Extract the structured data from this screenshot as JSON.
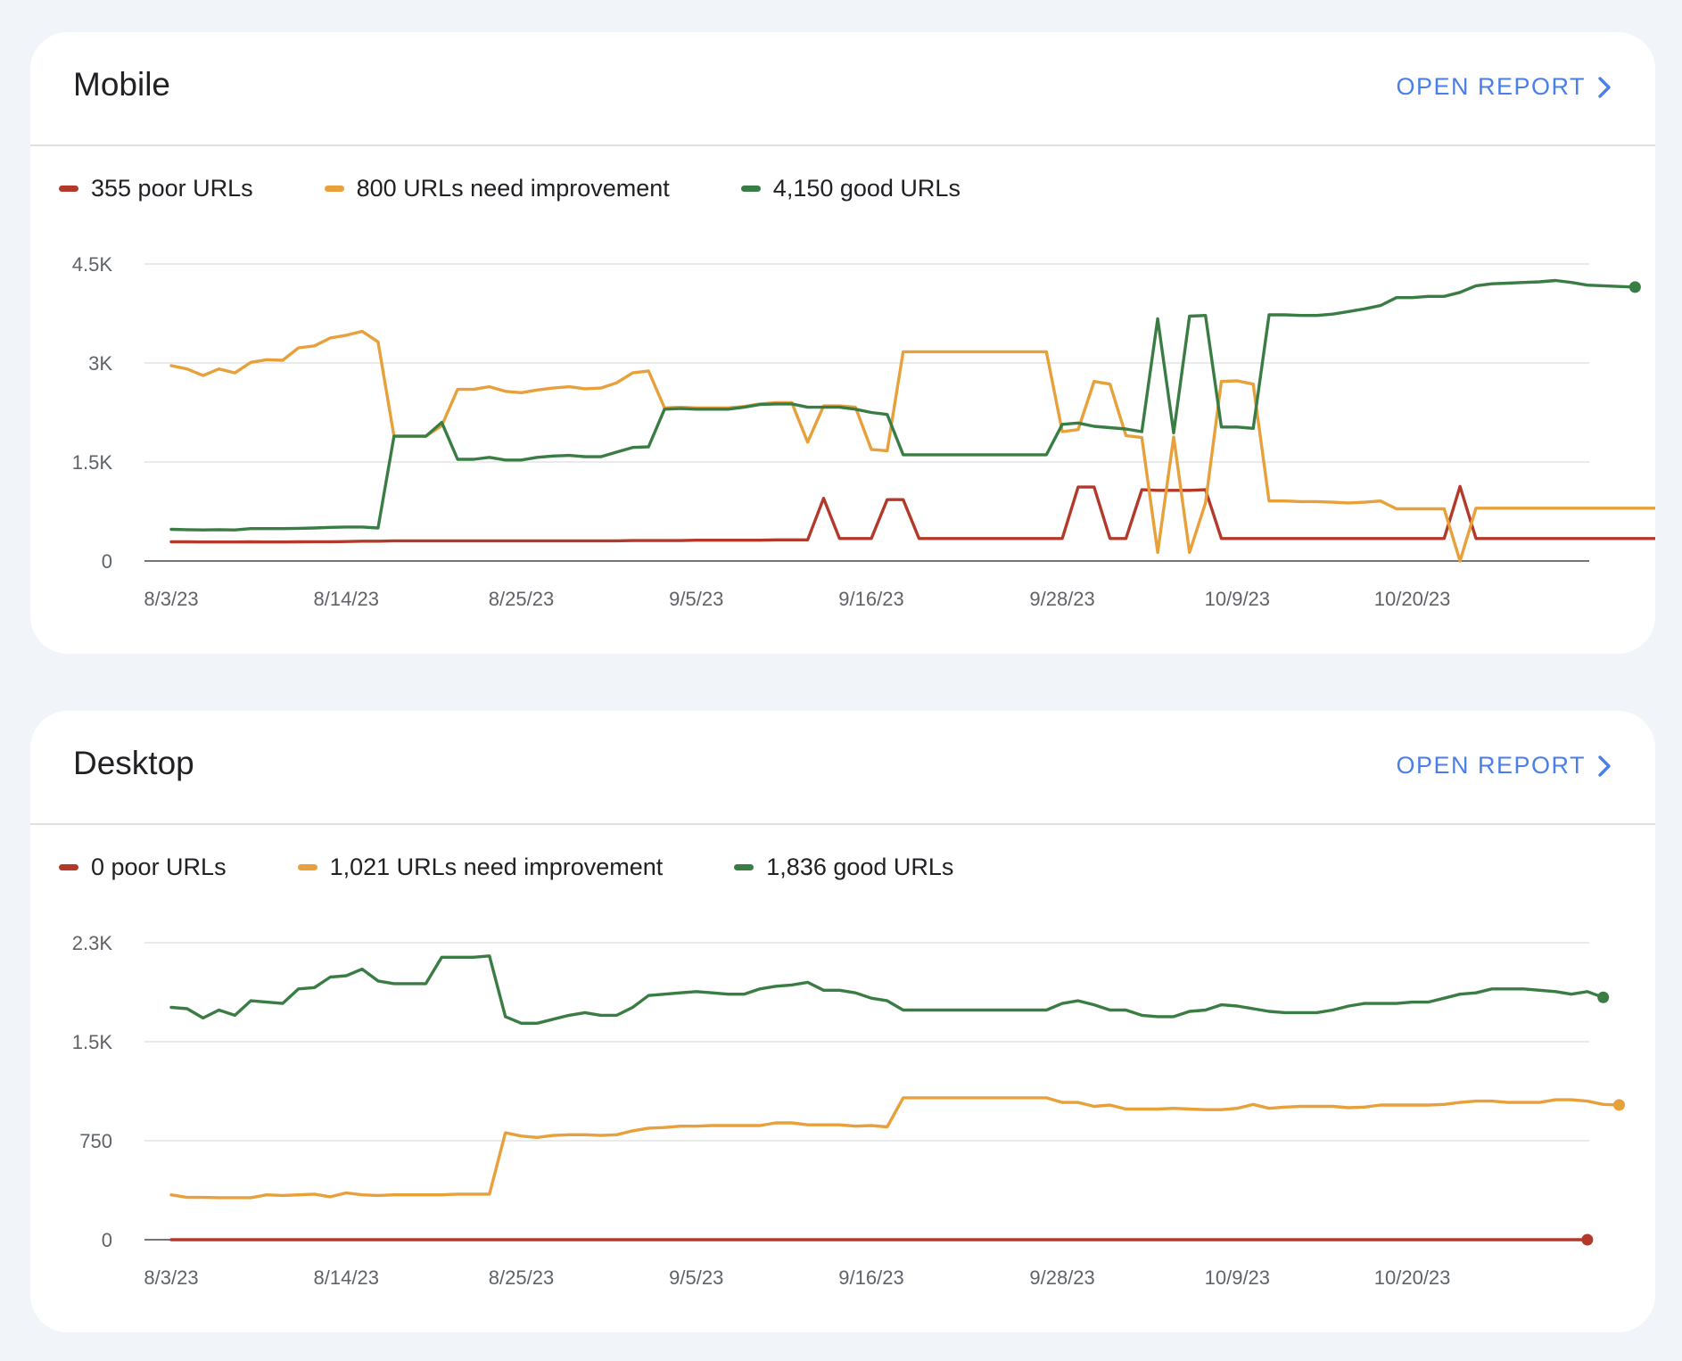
{
  "colors": {
    "poor": "#b3392b",
    "needs_improvement": "#e8a03a",
    "good": "#3a7d44",
    "link": "#4a7ee8"
  },
  "cards": [
    {
      "title": "Mobile",
      "open_report_label": "OPEN REPORT",
      "legend": [
        {
          "label": "355 poor URLs",
          "color": "#b3392b"
        },
        {
          "label": "800 URLs need improvement",
          "color": "#e8a03a"
        },
        {
          "label": "4,150 good URLs",
          "color": "#3a7d44"
        }
      ]
    },
    {
      "title": "Desktop",
      "open_report_label": "OPEN REPORT",
      "legend": [
        {
          "label": "0 poor URLs",
          "color": "#b3392b"
        },
        {
          "label": "1,021 URLs need improvement",
          "color": "#e8a03a"
        },
        {
          "label": "1,836 good URLs",
          "color": "#3a7d44"
        }
      ]
    }
  ],
  "chart_data": [
    {
      "type": "line",
      "title": "",
      "x": [
        "8/3/23",
        "8/4/23",
        "8/5/23",
        "8/6/23",
        "8/7/23",
        "8/8/23",
        "8/9/23",
        "8/10/23",
        "8/11/23",
        "8/12/23",
        "8/13/23",
        "8/14/23",
        "8/15/23",
        "8/16/23",
        "8/17/23",
        "8/18/23",
        "8/19/23",
        "8/20/23",
        "8/21/23",
        "8/22/23",
        "8/23/23",
        "8/24/23",
        "8/25/23",
        "8/26/23",
        "8/27/23",
        "8/28/23",
        "8/29/23",
        "8/30/23",
        "8/31/23",
        "9/1/23",
        "9/2/23",
        "9/3/23",
        "9/4/23",
        "9/5/23",
        "9/6/23",
        "9/7/23",
        "9/8/23",
        "9/9/23",
        "9/10/23",
        "9/11/23",
        "9/12/23",
        "9/13/23",
        "9/14/23",
        "9/15/23",
        "9/16/23",
        "9/17/23",
        "9/18/23",
        "9/19/23",
        "9/20/23",
        "9/21/23",
        "9/22/23",
        "9/23/23",
        "9/24/23",
        "9/25/23",
        "9/26/23",
        "9/27/23",
        "9/28/23",
        "9/29/23",
        "9/30/23",
        "10/1/23",
        "10/2/23",
        "10/3/23",
        "10/4/23",
        "10/5/23",
        "10/6/23",
        "10/7/23",
        "10/8/23",
        "10/9/23",
        "10/10/23",
        "10/11/23",
        "10/12/23",
        "10/13/23",
        "10/14/23",
        "10/15/23",
        "10/16/23",
        "10/17/23",
        "10/18/23",
        "10/19/23",
        "10/20/23",
        "10/21/23",
        "10/22/23",
        "10/23/23",
        "10/24/23",
        "10/25/23",
        "10/26/23",
        "10/27/23",
        "10/28/23",
        "10/29/23",
        "10/30/23"
      ],
      "x_tick_labels": [
        "8/3/23",
        "8/14/23",
        "8/25/23",
        "9/5/23",
        "9/16/23",
        "9/28/23",
        "10/9/23",
        "10/20/23"
      ],
      "y_ticks": [
        0,
        1500,
        3000,
        4500
      ],
      "y_tick_labels": [
        "0",
        "1.5K",
        "3K",
        "4.5K"
      ],
      "ylim": [
        0,
        4500
      ],
      "grid": true,
      "legend_position": "top-left",
      "series": [
        {
          "key": "poor",
          "name": "355 poor URLs",
          "color": "#b3392b",
          "values": [
            290,
            290,
            288,
            288,
            288,
            290,
            288,
            288,
            290,
            292,
            292,
            295,
            300,
            300,
            305,
            305,
            305,
            305,
            305,
            305,
            305,
            305,
            305,
            305,
            305,
            305,
            305,
            305,
            305,
            310,
            310,
            310,
            310,
            315,
            315,
            315,
            315,
            315,
            320,
            320,
            320,
            950,
            340,
            340,
            340,
            930,
            930,
            340,
            340,
            340,
            340,
            340,
            340,
            340,
            340,
            340,
            340,
            1120,
            1120,
            340,
            340,
            1080,
            1070,
            1070,
            1070,
            1080,
            340,
            340,
            340,
            340,
            340,
            340,
            340,
            340,
            340,
            340,
            340,
            340,
            340,
            340,
            340,
            1130,
            340,
            340,
            340,
            340,
            340,
            340,
            340,
            340,
            340,
            340,
            340,
            340,
            340,
            340
          ]
        },
        {
          "key": "needs_improvement",
          "name": "800 URLs need improvement",
          "color": "#e8a03a",
          "values": [
            2960,
            2910,
            2810,
            2910,
            2850,
            3010,
            3050,
            3040,
            3230,
            3260,
            3380,
            3420,
            3480,
            3320,
            1890,
            1890,
            1890,
            2050,
            2600,
            2600,
            2640,
            2570,
            2550,
            2590,
            2620,
            2640,
            2610,
            2620,
            2700,
            2850,
            2880,
            2320,
            2330,
            2320,
            2320,
            2320,
            2340,
            2380,
            2400,
            2400,
            1800,
            2350,
            2350,
            2330,
            1690,
            1670,
            3170,
            3170,
            3170,
            3170,
            3170,
            3170,
            3170,
            3170,
            3170,
            3170,
            1960,
            1990,
            2720,
            2680,
            1900,
            1870,
            130,
            1880,
            130,
            880,
            2720,
            2730,
            2680,
            910,
            910,
            900,
            900,
            890,
            880,
            890,
            910,
            790,
            790,
            790,
            790,
            0,
            800,
            800,
            800,
            800,
            800,
            800,
            800,
            800,
            800,
            800,
            800,
            800,
            800,
            800
          ]
        },
        {
          "key": "good",
          "name": "4,150 good URLs",
          "color": "#3a7d44",
          "values": [
            480,
            475,
            470,
            475,
            470,
            490,
            490,
            490,
            495,
            500,
            510,
            515,
            515,
            500,
            1890,
            1890,
            1890,
            2100,
            1540,
            1540,
            1570,
            1530,
            1530,
            1570,
            1590,
            1600,
            1580,
            1580,
            1650,
            1720,
            1730,
            2300,
            2310,
            2300,
            2300,
            2300,
            2330,
            2370,
            2380,
            2380,
            2330,
            2330,
            2330,
            2300,
            2250,
            2220,
            1610,
            1610,
            1610,
            1610,
            1610,
            1610,
            1610,
            1610,
            1610,
            1610,
            2070,
            2090,
            2040,
            2020,
            2000,
            1960,
            3670,
            1940,
            3710,
            3720,
            2030,
            2030,
            2010,
            3730,
            3730,
            3720,
            3720,
            3740,
            3780,
            3820,
            3870,
            3990,
            3990,
            4010,
            4010,
            4070,
            4170,
            4200,
            4210,
            4220,
            4230,
            4250,
            4220,
            4180,
            4170,
            4160,
            4150
          ]
        }
      ]
    },
    {
      "type": "line",
      "title": "",
      "x": [
        "8/3/23",
        "8/4/23",
        "8/5/23",
        "8/6/23",
        "8/7/23",
        "8/8/23",
        "8/9/23",
        "8/10/23",
        "8/11/23",
        "8/12/23",
        "8/13/23",
        "8/14/23",
        "8/15/23",
        "8/16/23",
        "8/17/23",
        "8/18/23",
        "8/19/23",
        "8/20/23",
        "8/21/23",
        "8/22/23",
        "8/23/23",
        "8/24/23",
        "8/25/23",
        "8/26/23",
        "8/27/23",
        "8/28/23",
        "8/29/23",
        "8/30/23",
        "8/31/23",
        "9/1/23",
        "9/2/23",
        "9/3/23",
        "9/4/23",
        "9/5/23",
        "9/6/23",
        "9/7/23",
        "9/8/23",
        "9/9/23",
        "9/10/23",
        "9/11/23",
        "9/12/23",
        "9/13/23",
        "9/14/23",
        "9/15/23",
        "9/16/23",
        "9/17/23",
        "9/18/23",
        "9/19/23",
        "9/20/23",
        "9/21/23",
        "9/22/23",
        "9/23/23",
        "9/24/23",
        "9/25/23",
        "9/26/23",
        "9/27/23",
        "9/28/23",
        "9/29/23",
        "9/30/23",
        "10/1/23",
        "10/2/23",
        "10/3/23",
        "10/4/23",
        "10/5/23",
        "10/6/23",
        "10/7/23",
        "10/8/23",
        "10/9/23",
        "10/10/23",
        "10/11/23",
        "10/12/23",
        "10/13/23",
        "10/14/23",
        "10/15/23",
        "10/16/23",
        "10/17/23",
        "10/18/23",
        "10/19/23",
        "10/20/23",
        "10/21/23",
        "10/22/23",
        "10/23/23",
        "10/24/23",
        "10/25/23",
        "10/26/23",
        "10/27/23",
        "10/28/23",
        "10/29/23",
        "10/30/23"
      ],
      "x_tick_labels": [
        "8/3/23",
        "8/14/23",
        "8/25/23",
        "9/5/23",
        "9/16/23",
        "9/28/23",
        "10/9/23",
        "10/20/23"
      ],
      "y_ticks": [
        0,
        750,
        1500,
        2250
      ],
      "y_tick_labels": [
        "0",
        "750",
        "1.5K",
        "2.3K"
      ],
      "ylim": [
        0,
        2250
      ],
      "grid": true,
      "legend_position": "top-left",
      "series": [
        {
          "key": "poor",
          "name": "0 poor URLs",
          "color": "#b3392b",
          "values": [
            0,
            0,
            0,
            0,
            0,
            0,
            0,
            0,
            0,
            0,
            0,
            0,
            0,
            0,
            0,
            0,
            0,
            0,
            0,
            0,
            0,
            0,
            0,
            0,
            0,
            0,
            0,
            0,
            0,
            0,
            0,
            0,
            0,
            0,
            0,
            0,
            0,
            0,
            0,
            0,
            0,
            0,
            0,
            0,
            0,
            0,
            0,
            0,
            0,
            0,
            0,
            0,
            0,
            0,
            0,
            0,
            0,
            0,
            0,
            0,
            0,
            0,
            0,
            0,
            0,
            0,
            0,
            0,
            0,
            0,
            0,
            0,
            0,
            0,
            0,
            0,
            0,
            0,
            0,
            0,
            0,
            0,
            0,
            0,
            0,
            0,
            0,
            0,
            0,
            0
          ]
        },
        {
          "key": "needs_improvement",
          "name": "1,021 URLs need improvement",
          "color": "#e8a03a",
          "values": [
            340,
            320,
            320,
            318,
            318,
            318,
            340,
            335,
            340,
            345,
            325,
            355,
            340,
            335,
            340,
            340,
            340,
            340,
            345,
            345,
            345,
            810,
            785,
            775,
            790,
            795,
            795,
            790,
            795,
            825,
            845,
            850,
            860,
            860,
            865,
            865,
            865,
            865,
            885,
            885,
            870,
            870,
            870,
            860,
            865,
            855,
            1075,
            1075,
            1075,
            1075,
            1075,
            1075,
            1075,
            1075,
            1075,
            1075,
            1040,
            1040,
            1010,
            1020,
            990,
            990,
            990,
            995,
            990,
            985,
            985,
            995,
            1025,
            995,
            1005,
            1010,
            1010,
            1010,
            1000,
            1005,
            1020,
            1020,
            1020,
            1020,
            1025,
            1040,
            1050,
            1050,
            1040,
            1040,
            1040,
            1060,
            1060,
            1050,
            1025,
            1021
          ]
        },
        {
          "key": "good",
          "name": "1,836 good URLs",
          "color": "#3a7d44",
          "values": [
            1760,
            1750,
            1680,
            1740,
            1700,
            1810,
            1800,
            1790,
            1900,
            1910,
            1990,
            2000,
            2050,
            1960,
            1940,
            1940,
            1940,
            2140,
            2140,
            2140,
            2150,
            1690,
            1640,
            1640,
            1670,
            1700,
            1720,
            1700,
            1700,
            1760,
            1850,
            1860,
            1870,
            1880,
            1870,
            1860,
            1860,
            1900,
            1920,
            1930,
            1950,
            1890,
            1890,
            1870,
            1830,
            1810,
            1740,
            1740,
            1740,
            1740,
            1740,
            1740,
            1740,
            1740,
            1740,
            1740,
            1790,
            1810,
            1780,
            1740,
            1740,
            1700,
            1690,
            1690,
            1730,
            1740,
            1780,
            1770,
            1750,
            1730,
            1720,
            1720,
            1720,
            1740,
            1770,
            1790,
            1790,
            1790,
            1800,
            1800,
            1830,
            1860,
            1870,
            1900,
            1900,
            1900,
            1890,
            1880,
            1860,
            1880,
            1836
          ]
        }
      ]
    }
  ]
}
